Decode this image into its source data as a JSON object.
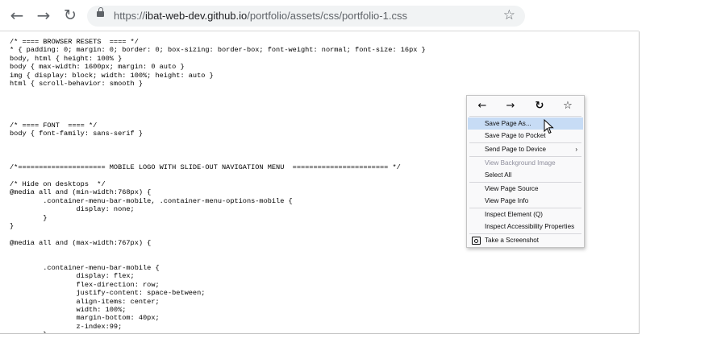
{
  "browser": {
    "back_icon": "←",
    "forward_icon": "→",
    "reload_icon": "↻",
    "star_icon": "☆",
    "url_scheme": "https://",
    "url_host": "ibat-web-dev.github.io",
    "url_path": "/portfolio/assets/css/portfolio-1.css"
  },
  "code_lines": [
    "/* ==== BROWSER RESETS  ==== */",
    "* { padding: 0; margin: 0; border: 0; box-sizing: border-box; font-weight: normal; font-size: 16px }",
    "body, html { height: 100% }",
    "body { max-width: 1600px; margin: 0 auto }",
    "img { display: block; width: 100%; height: auto }",
    "html { scroll-behavior: smooth }",
    "",
    "",
    "",
    "",
    "/* ==== FONT  ==== */",
    "body { font-family: sans-serif }",
    "",
    "",
    "",
    "/*===================== MOBILE LOGO WITH SLIDE-OUT NAVIGATION MENU  ======================= */",
    "",
    "/* Hide on desktops  */",
    "@media all and (min-width:768px) {",
    "        .container-menu-bar-mobile, .container-menu-options-mobile {",
    "                display: none;",
    "        }",
    "}",
    "",
    "@media all and (max-width:767px) {",
    "",
    "",
    "        .container-menu-bar-mobile {",
    "                display: flex;",
    "                flex-direction: row;",
    "                justify-content: space-between;",
    "                align-items: center;",
    "                width: 100%;",
    "                margin-bottom: 40px;",
    "                z-index:99;",
    "        }"
  ],
  "context_menu": {
    "back_icon": "←",
    "forward_icon": "→",
    "reload_icon": "↻",
    "bookmark_icon": "☆",
    "items": [
      {
        "label": "Save Page As...",
        "disabled": false,
        "hover": true
      },
      {
        "label": "Save Page to Pocket",
        "disabled": false
      },
      {
        "label": "Send Page to Device",
        "disabled": false,
        "submenu": "›"
      },
      {
        "label": "View Background Image",
        "disabled": true
      },
      {
        "label": "Select All",
        "disabled": false
      },
      {
        "label": "View Page Source",
        "disabled": false
      },
      {
        "label": "View Page Info",
        "disabled": false
      },
      {
        "label": "Inspect Element (Q)",
        "disabled": false
      },
      {
        "label": "Inspect Accessibility Properties",
        "disabled": false
      },
      {
        "label": "Take a Screenshot",
        "disabled": false
      }
    ]
  }
}
